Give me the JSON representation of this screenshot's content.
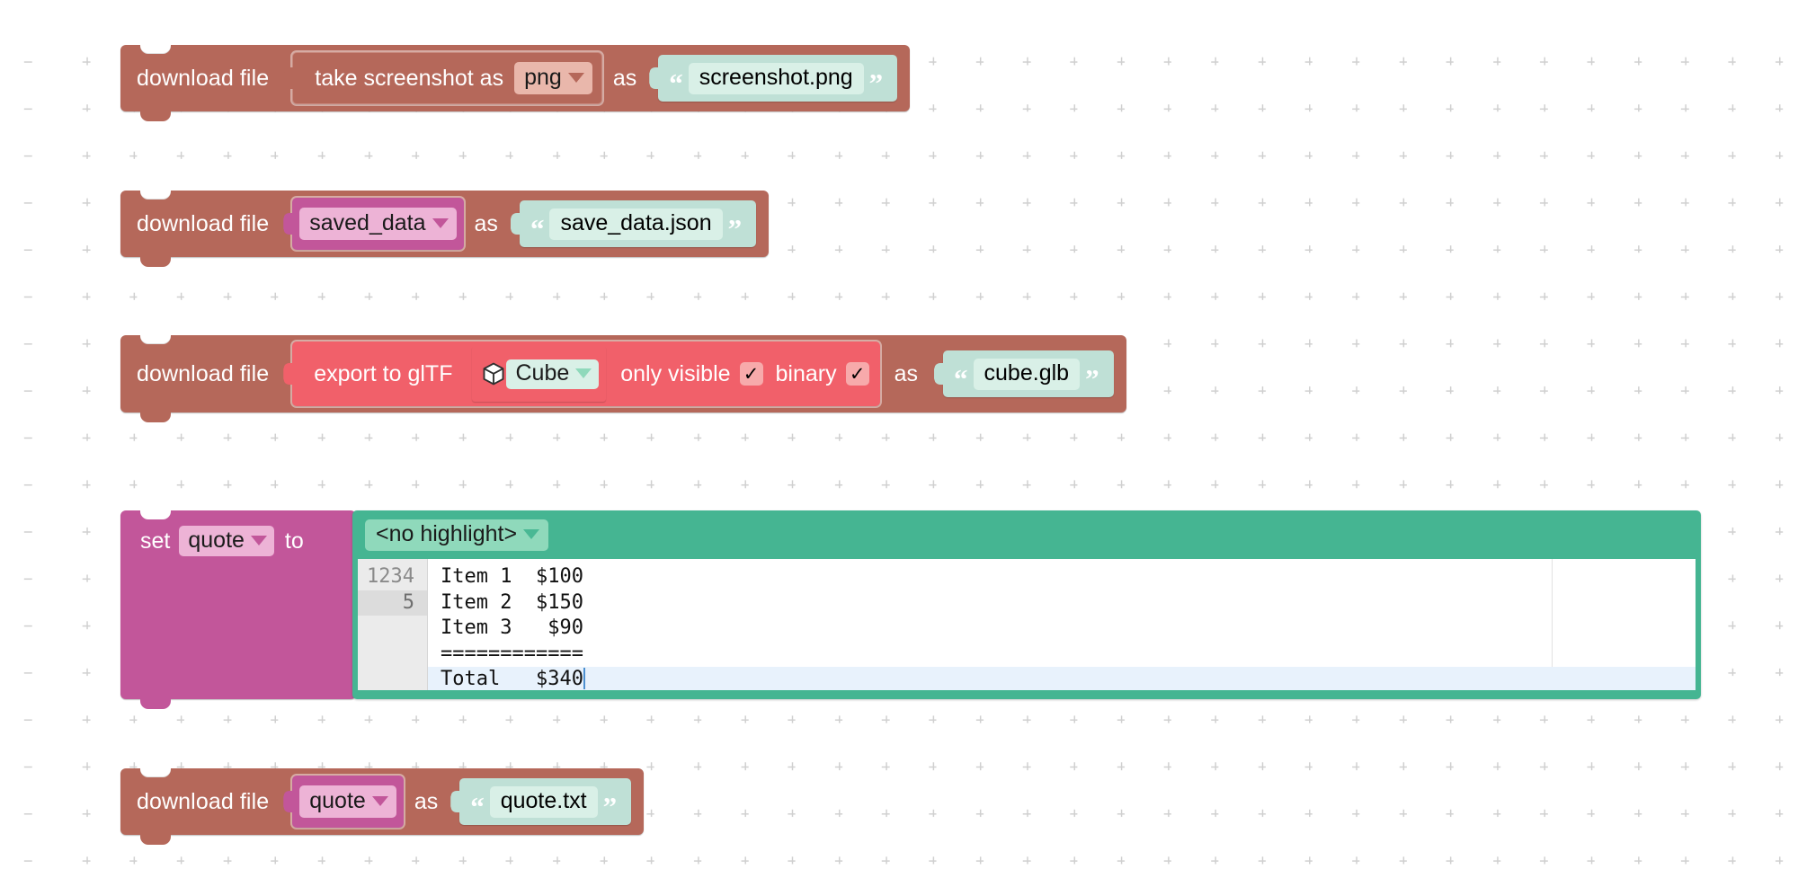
{
  "workspace": {
    "background": "#ffffff",
    "grid_color": "#d0d0d0"
  },
  "colors": {
    "statement_brown": "#b5685a",
    "text_mint": "#bfe0d6",
    "variable_magenta": "#c2569a",
    "gltf_red": "#f1606a",
    "code_green": "#45b592",
    "active_line": "#e8f2fc"
  },
  "blocks": [
    {
      "id": "download-screenshot",
      "statement_label": "download file",
      "connector_label": "as",
      "inner": {
        "label": "take screenshot as",
        "dropdown_value": "png"
      },
      "filename": "screenshot.png",
      "quote_open": "“",
      "quote_close": "”"
    },
    {
      "id": "download-saved-data",
      "statement_label": "download file",
      "connector_label": "as",
      "variable_value": "saved_data",
      "filename": "save_data.json",
      "quote_open": "“",
      "quote_close": "”"
    },
    {
      "id": "download-gltf",
      "statement_label": "download file",
      "connector_label": "as",
      "inner": {
        "label": "export to glTF",
        "object_name": "Cube",
        "option_only_visible_label": "only visible",
        "option_only_visible_checked": "✓",
        "option_binary_label": "binary",
        "option_binary_checked": "✓"
      },
      "filename": "cube.glb",
      "quote_open": "“",
      "quote_close": "”"
    },
    {
      "id": "download-quote",
      "statement_label": "download file",
      "connector_label": "as",
      "variable_value": "quote",
      "filename": "quote.txt",
      "quote_open": "“",
      "quote_close": "”"
    }
  ],
  "set_block": {
    "keyword_set": "set",
    "variable_value": "quote",
    "keyword_to": "to",
    "highlight_mode": "<no highlight>",
    "editor": {
      "lines": [
        {
          "number": "1",
          "text": "Item 1  $100",
          "active": false
        },
        {
          "number": "2",
          "text": "Item 2  $150",
          "active": false
        },
        {
          "number": "3",
          "text": "Item 3   $90",
          "active": false
        },
        {
          "number": "4",
          "text": "============",
          "active": false
        },
        {
          "number": "5",
          "text": "Total   $340",
          "active": true
        }
      ],
      "cursor_line": "5"
    }
  }
}
